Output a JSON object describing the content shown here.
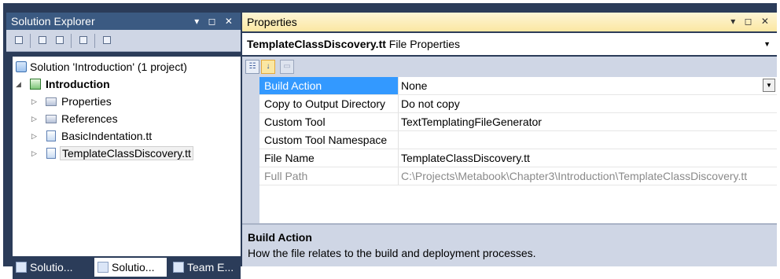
{
  "solution_explorer": {
    "title": "Solution Explorer",
    "title_controls": "▾ ◻ ✕",
    "toolbar_icons": [
      "properties-icon",
      "show-all-files-icon",
      "refresh-icon",
      "view-code-icon",
      "class-diagram-icon"
    ],
    "tree": {
      "solution": "Solution 'Introduction' (1 project)",
      "project": "Introduction",
      "items": [
        "Properties",
        "References",
        "BasicIndentation.tt",
        "TemplateClassDiscovery.tt"
      ]
    },
    "tabs": [
      "Solutio...",
      "Solutio...",
      "Team E..."
    ]
  },
  "properties": {
    "title": "Properties",
    "title_controls": "▾ ◻ ✕",
    "object_name": "TemplateClassDiscovery.tt",
    "object_type": " File Properties",
    "toolbar_icons": [
      "categorized-icon",
      "alphabetical-icon",
      "property-pages-icon"
    ],
    "rows": [
      {
        "name": "Build Action",
        "value": "None"
      },
      {
        "name": "Copy to Output Directory",
        "value": "Do not copy"
      },
      {
        "name": "Custom Tool",
        "value": "TextTemplatingFileGenerator"
      },
      {
        "name": "Custom Tool Namespace",
        "value": ""
      },
      {
        "name": "File Name",
        "value": "TemplateClassDiscovery.tt"
      },
      {
        "name": "Full Path",
        "value": "C:\\Projects\\Metabook\\Chapter3\\Introduction\\TemplateClassDiscovery.tt"
      }
    ],
    "description": {
      "title": "Build Action",
      "text": "How the file relates to the build and deployment processes."
    }
  },
  "colors": {
    "frame": "#2b3c59",
    "inactive_title": "#3b5a82",
    "active_title": "#fbe7a2",
    "selection": "#3399ff"
  }
}
